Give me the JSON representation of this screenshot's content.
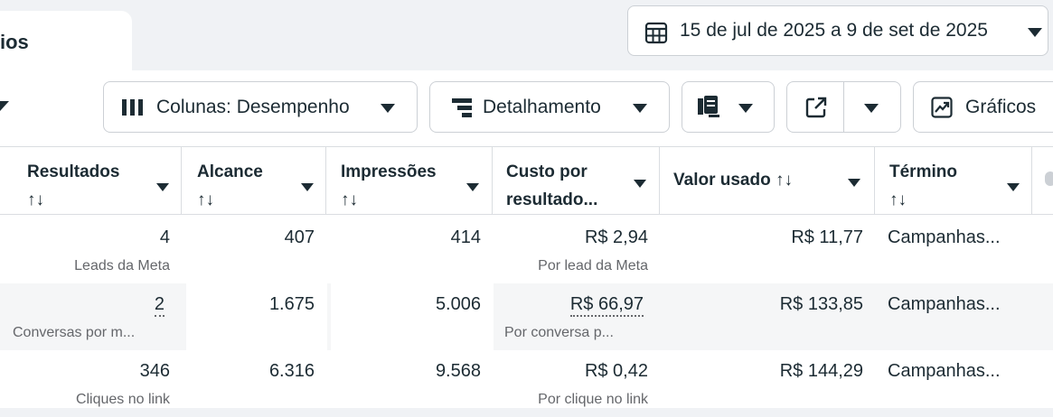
{
  "tab": {
    "label": "ios"
  },
  "date_range": {
    "label": "15 de jul de 2025 a 9 de set de 2025"
  },
  "toolbar": {
    "columns_label": "Colunas: Desempenho",
    "breakdown_label": "Detalhamento",
    "charts_label": "Gráficos"
  },
  "table": {
    "headers": [
      {
        "line1": "Resultados",
        "line2": "↑↓"
      },
      {
        "line1": "Alcance",
        "line2": "↑↓"
      },
      {
        "line1": "Impressões",
        "line2": "↑↓"
      },
      {
        "line1": "Custo por",
        "line2": "resultado..."
      },
      {
        "line1": "Valor usado ↑↓",
        "line2": ""
      },
      {
        "line1": "Término",
        "line2": "↑↓"
      }
    ],
    "rows": [
      {
        "results": "4",
        "results_sub": "Leads da Meta",
        "reach": "407",
        "impressions": "414",
        "cost": "R$ 2,94",
        "cost_sub": "Por lead da Meta",
        "spent": "R$ 11,77",
        "end": "Campanhas..."
      },
      {
        "results": "2",
        "results_sub": "Conversas por m...",
        "reach": "1.675",
        "impressions": "5.006",
        "cost": "R$ 66,97",
        "cost_sub": "Por conversa p...",
        "spent": "R$ 133,85",
        "end": "Campanhas..."
      },
      {
        "results": "346",
        "results_sub": "Cliques no link",
        "reach": "6.316",
        "impressions": "9.568",
        "cost": "R$ 0,42",
        "cost_sub": "Por clique no link",
        "spent": "R$ 144,29",
        "end": "Campanhas..."
      }
    ]
  }
}
